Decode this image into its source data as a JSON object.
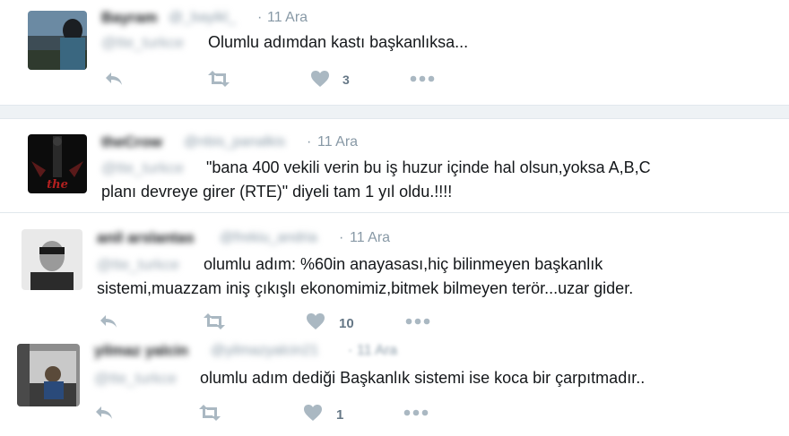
{
  "tweets": [
    {
      "name": "Bayram",
      "handle": "@_bayikl_",
      "date": "11 Ara",
      "mention": "@tte_turkce",
      "lines": [
        "Olumlu adımdan kastı başkanlıksa..."
      ],
      "likes": "3"
    },
    {
      "name": "theCrow",
      "handle": "@nbis_panalkis",
      "date": "11 Ara",
      "mention": "@tte_turkce",
      "lines": [
        "\"bana 400 vekili verin bu iş huzur içinde hal olsun,yoksa A,B,C",
        "planı devreye girer (RTE)\" diyeli tam 1 yıl oldu.!!!!"
      ],
      "likes": ""
    },
    {
      "name": "anil arslantas",
      "handle": "@frekiu_andria",
      "date": "11 Ara",
      "mention": "@tte_turkce",
      "lines": [
        "olumlu adım: %60in anayasası,hiç bilinmeyen başkanlık",
        "sistemi,muazzam iniş çıkışlı ekonomimiz,bitmek bilmeyen terör...uzar gider."
      ],
      "likes": "10"
    },
    {
      "name": "yilmaz yalcin",
      "handle": "@yilmazyalcin21",
      "date": "11 Ara",
      "mention": "@tte_turkce",
      "lines": [
        "olumlu adım dediği Başkanlık sistemi ise koca bir çarpıtmadır.."
      ],
      "likes": "1"
    }
  ],
  "colors": {
    "accent": "#1da1f2",
    "action_icon": "#aab8c2",
    "muted": "#8899a6",
    "separator": "#e6ecf0"
  },
  "icons": [
    "reply-icon",
    "retweet-icon",
    "heart-icon",
    "more-icon"
  ]
}
